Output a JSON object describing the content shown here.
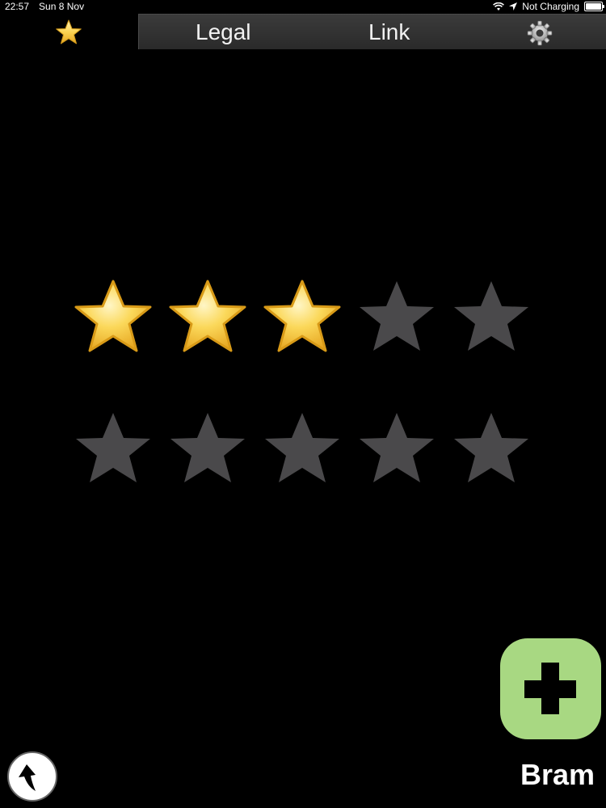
{
  "status_bar": {
    "time": "22:57",
    "date": "Sun 8 Nov",
    "charging": "Not Charging"
  },
  "toolbar": {
    "favorites_icon": "star-icon",
    "legal_label": "Legal",
    "link_label": "Link",
    "settings_icon": "gear-icon"
  },
  "rating": {
    "rows": [
      {
        "total": 5,
        "filled": 3
      },
      {
        "total": 5,
        "filled": 0
      }
    ],
    "filled_color": "#f5c542",
    "empty_color": "#4a494b"
  },
  "add_button": {
    "icon": "plus-icon",
    "color": "#a8d882"
  },
  "user": {
    "name": "Bram"
  },
  "back_button": {
    "icon": "back-arrow-icon"
  }
}
